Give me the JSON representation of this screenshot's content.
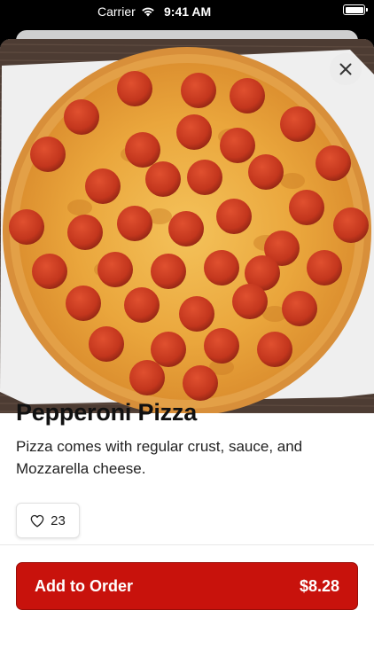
{
  "status_bar": {
    "carrier": "Carrier",
    "time": "9:41 AM"
  },
  "item": {
    "name": "Pepperoni Pizza",
    "description": "Pizza comes with regular crust, sauce, and Mozzarella cheese.",
    "likes": "23",
    "image": "pepperoni-pizza-photo"
  },
  "icons": {
    "close": "close-icon",
    "heart": "heart-icon",
    "wifi": "wifi-icon",
    "battery": "battery-icon"
  },
  "footer": {
    "add_label": "Add to Order",
    "price": "$8.28"
  },
  "colors": {
    "primary": "#c8120c",
    "background": "#ffffff",
    "text": "#111111"
  }
}
